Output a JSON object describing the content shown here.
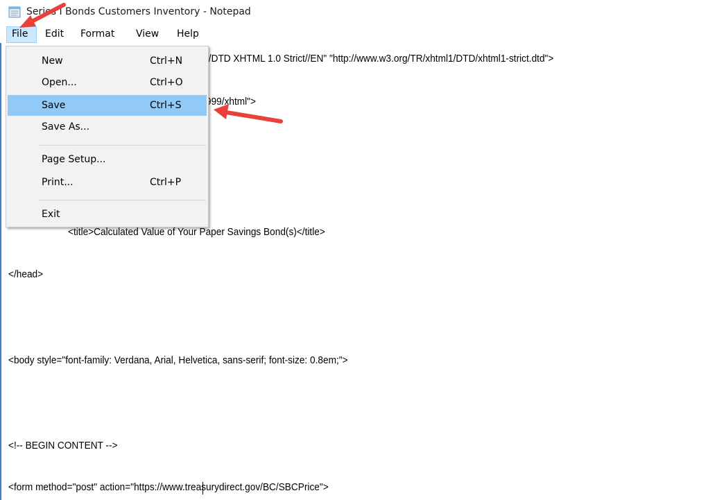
{
  "window": {
    "title": "Series I Bonds Customers Inventory - Notepad"
  },
  "menubar": {
    "items": [
      "File",
      "Edit",
      "Format",
      "View",
      "Help"
    ],
    "open_menu": "File"
  },
  "file_menu": {
    "items": [
      {
        "label": "New",
        "shortcut": "Ctrl+N"
      },
      {
        "label": "Open...",
        "shortcut": "Ctrl+O"
      },
      {
        "label": "Save",
        "shortcut": "Ctrl+S",
        "highlighted": true
      },
      {
        "label": "Save As...",
        "shortcut": ""
      },
      {
        "label": "Page Setup...",
        "shortcut": ""
      },
      {
        "label": "Print...",
        "shortcut": "Ctrl+P"
      },
      {
        "label": "Exit",
        "shortcut": ""
      }
    ]
  },
  "editor": {
    "lines": [
      "//DTD XHTML 1.0 Strict//EN\" \"http://www.w3.org/TR/xhtml1/DTD/xhtml1-strict.dtd\">",
      "999/xhtml\">",
      "<title>Calculated Value of Your Paper Savings Bond(s)</title>",
      "</head>",
      "<body style=\"font-family: Verdana, Arial, Helvetica, sans-serif; font-size: 0.8em;\">",
      "<!-- BEGIN CONTENT -->",
      "<form method=\"post\" action=\"https://www.treasurydirect.gov/BC/SBCPrice\">"
    ]
  },
  "colors": {
    "menu_highlight": "#91c9f7",
    "menu_open": "#cce8ff",
    "editor_border": "#3b7fd4",
    "arrow": "#e8413c"
  },
  "icons": {
    "app": "notepad-icon"
  }
}
